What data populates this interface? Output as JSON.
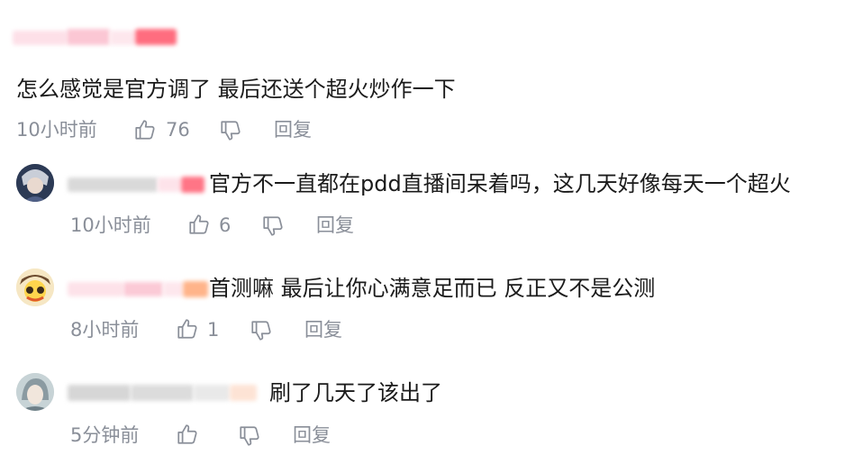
{
  "main_comment": {
    "text": "怎么感觉是官方调了 最后还送个超火炒作一下",
    "time": "10小时前",
    "likes": "76",
    "reply_label": "回复"
  },
  "replies": [
    {
      "text": "官方不一直都在pdd直播间呆着吗，这几天好像每天一个超火",
      "time": "10小时前",
      "likes": "6",
      "reply_label": "回复"
    },
    {
      "text": "首测嘛 最后让你心满意足而已 反正又不是公测",
      "time": "8小时前",
      "likes": "1",
      "reply_label": "回复"
    },
    {
      "text": "刷了几天了该出了",
      "time": "5分钟前",
      "likes": "",
      "reply_label": "回复"
    }
  ],
  "colors": {
    "meta_gray": "#8a8f99",
    "blur_pink": "#f7a9bd",
    "blur_red": "#ff5a6e",
    "blur_orange": "#ffb48a"
  }
}
